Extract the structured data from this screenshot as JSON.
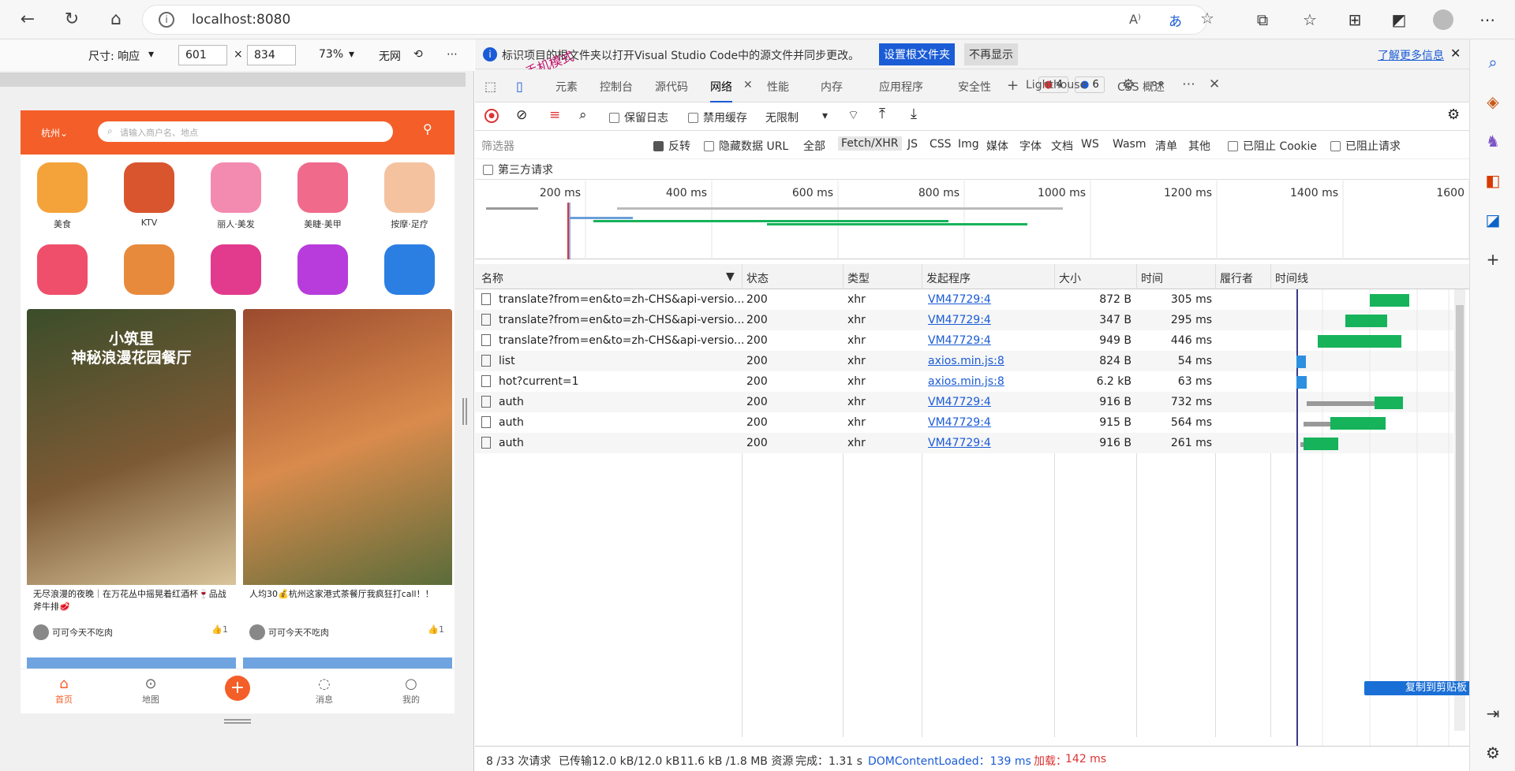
{
  "browser": {
    "url": "localhost:8080",
    "font_icon": "A⁾",
    "translate_icon": "あ"
  },
  "emulation": {
    "size_label": "尺寸: 响应",
    "width": "601",
    "height": "834",
    "times": "×",
    "zoom": "73%",
    "throttle": "无网"
  },
  "phone": {
    "city": "杭州⌄",
    "search_placeholder": "请输入商户名、地点",
    "categories": [
      {
        "label": "美食",
        "color": "#f4a33a"
      },
      {
        "label": "KTV",
        "color": "#d9552e"
      },
      {
        "label": "丽人·美发",
        "color": "#f38bb0"
      },
      {
        "label": "美睫·美甲",
        "color": "#f06a8c"
      },
      {
        "label": "按摩·足疗",
        "color": "#f5c2a0"
      },
      {
        "label": "",
        "color": "#ef4f6a"
      },
      {
        "label": "",
        "color": "#e88a3b"
      },
      {
        "label": "",
        "color": "#e23a8c"
      },
      {
        "label": "",
        "color": "#b83cdb"
      },
      {
        "label": "",
        "color": "#2b7fe3"
      }
    ],
    "cards": [
      {
        "title": "小筑里\n神秘浪漫花园餐厅",
        "desc": "无尽浪漫的夜晚｜在万花丛中摇晃着红酒杯🍷品战斧牛排🥩",
        "author": "可可今天不吃肉",
        "likes": "1"
      },
      {
        "title": "",
        "desc": "人均30💰杭州这家港式茶餐厅我疯狂打call！！",
        "author": "可可今天不吃肉",
        "likes": "1"
      }
    ],
    "tabs": [
      {
        "label": "首页",
        "icon": "⌂"
      },
      {
        "label": "地图",
        "icon": "⊙"
      },
      {
        "label": "",
        "icon": "+"
      },
      {
        "label": "消息",
        "icon": "◌"
      },
      {
        "label": "我的",
        "icon": "○"
      }
    ]
  },
  "notice": {
    "text": "标识项目的根文件夹以打开Visual Studio Code中的源文件并同步更改。",
    "set_root": "设置根文件夹",
    "dismiss": "不再显示",
    "learn_more": "了解更多信息",
    "overlay": "手机模式"
  },
  "devtools_tabs": [
    "元素",
    "控制台",
    "源代码",
    "网络",
    "性能",
    "内存",
    "应用程序",
    "安全性",
    "Lighthouse",
    "CSS 概述"
  ],
  "badges": {
    "errors": "4",
    "messages": "6"
  },
  "net_toolbar": {
    "preserve_log": "保留日志",
    "disable_cache": "禁用缓存",
    "throttle": "无限制"
  },
  "filter": {
    "placeholder": "筛选器",
    "invert": "反转",
    "hide_data_url": "隐藏数据 URL",
    "types": [
      "全部",
      "Fetch/XHR",
      "JS",
      "CSS",
      "Img",
      "媒体",
      "字体",
      "文档",
      "WS",
      "Wasm",
      "清单",
      "其他"
    ],
    "blocked_cookies": "已阻止 Cookie",
    "blocked_requests": "已阻止请求",
    "third_party": "第三方请求"
  },
  "timeline_ticks": [
    {
      "label": "200 ms",
      "ms": 200
    },
    {
      "label": "400 ms",
      "ms": 400
    },
    {
      "label": "600 ms",
      "ms": 600
    },
    {
      "label": "800 ms",
      "ms": 800
    },
    {
      "label": "1000 ms",
      "ms": 1000
    },
    {
      "label": "1200 ms",
      "ms": 1200
    },
    {
      "label": "1400 ms",
      "ms": 1400
    },
    {
      "label": "1600",
      "ms": 1600
    }
  ],
  "columns": [
    "名称",
    "状态",
    "类型",
    "发起程序",
    "大小",
    "时间",
    "履行者",
    "时间线"
  ],
  "requests": [
    {
      "name": "translate?from=en&to=zh-CHS&api-versio...",
      "status": "200",
      "type": "xhr",
      "initiator": "VM47729:4",
      "size": "872 B",
      "time": "305 ms"
    },
    {
      "name": "translate?from=en&to=zh-CHS&api-versio...",
      "status": "200",
      "type": "xhr",
      "initiator": "VM47729:4",
      "size": "347 B",
      "time": "295 ms"
    },
    {
      "name": "translate?from=en&to=zh-CHS&api-versio...",
      "status": "200",
      "type": "xhr",
      "initiator": "VM47729:4",
      "size": "949 B",
      "time": "446 ms"
    },
    {
      "name": "list",
      "status": "200",
      "type": "xhr",
      "initiator": "axios.min.js:8",
      "size": "824 B",
      "time": "54 ms"
    },
    {
      "name": "hot?current=1",
      "status": "200",
      "type": "xhr",
      "initiator": "axios.min.js:8",
      "size": "6.2 kB",
      "time": "63 ms"
    },
    {
      "name": "auth",
      "status": "200",
      "type": "xhr",
      "initiator": "VM47729:4",
      "size": "916 B",
      "time": "732 ms"
    },
    {
      "name": "auth",
      "status": "200",
      "type": "xhr",
      "initiator": "VM47729:4",
      "size": "915 B",
      "time": "564 ms"
    },
    {
      "name": "auth",
      "status": "200",
      "type": "xhr",
      "initiator": "VM47729:4",
      "size": "916 B",
      "time": "261 ms"
    }
  ],
  "copy_clipboard": "复制到剪贴板",
  "status_bar": {
    "requests": "8 /33 次请求",
    "transferred": "已传输12.0 kB/12.0 kB",
    "resources": "11.6 kB /1.8 MB 资源",
    "finish": "完成：1.31 s",
    "dcl": "DOMContentLoaded：139 ms",
    "load_label": "加载：",
    "load_value": "142 ms"
  },
  "colors": {
    "accent": "#f45e28",
    "link": "#1a5bd6",
    "green": "#16b35a",
    "load": "#d33"
  }
}
